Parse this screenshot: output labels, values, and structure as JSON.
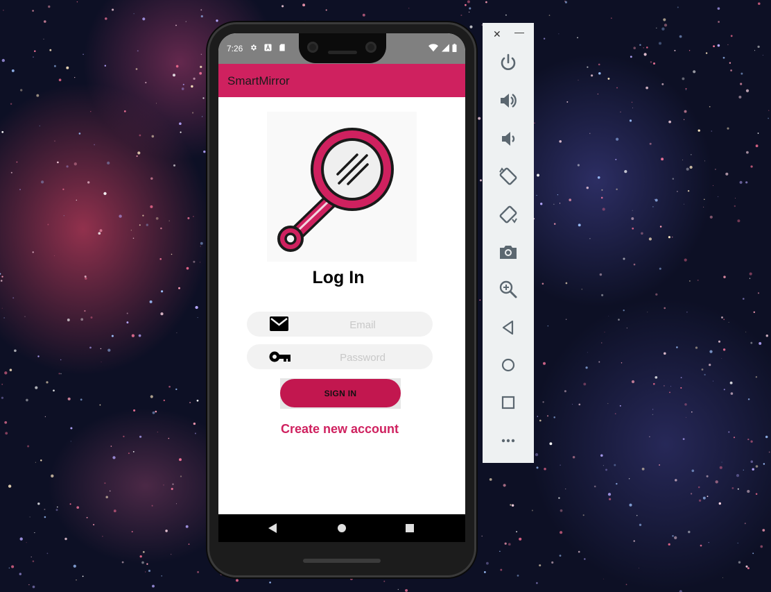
{
  "status_bar": {
    "time": "7:26",
    "icons": [
      "gear-icon",
      "a-icon",
      "sd-card-icon"
    ],
    "right_icons": [
      "wifi-icon",
      "signal-icon",
      "battery-icon"
    ]
  },
  "app": {
    "title": "SmartMirror"
  },
  "login": {
    "title": "Log In",
    "email_placeholder": "Email",
    "password_placeholder": "Password",
    "signin_label": "SIGN IN",
    "create_account_label": "Create new account"
  },
  "colors": {
    "accent": "#cf215f",
    "button": "#c2174f",
    "status_bar": "#808080"
  },
  "navigation": {
    "buttons": [
      "back-icon",
      "home-icon",
      "recents-icon"
    ]
  },
  "emulator_toolbar": {
    "window_buttons": [
      "close-icon",
      "minimize-icon"
    ],
    "window_glyphs": {
      "close": "✕",
      "minimize": "—"
    },
    "buttons": [
      "power-icon",
      "volume-up-icon",
      "volume-down-icon",
      "rotate-left-icon",
      "rotate-right-icon",
      "camera-icon",
      "zoom-icon",
      "back-icon",
      "home-icon",
      "overview-icon",
      "more-icon"
    ]
  }
}
